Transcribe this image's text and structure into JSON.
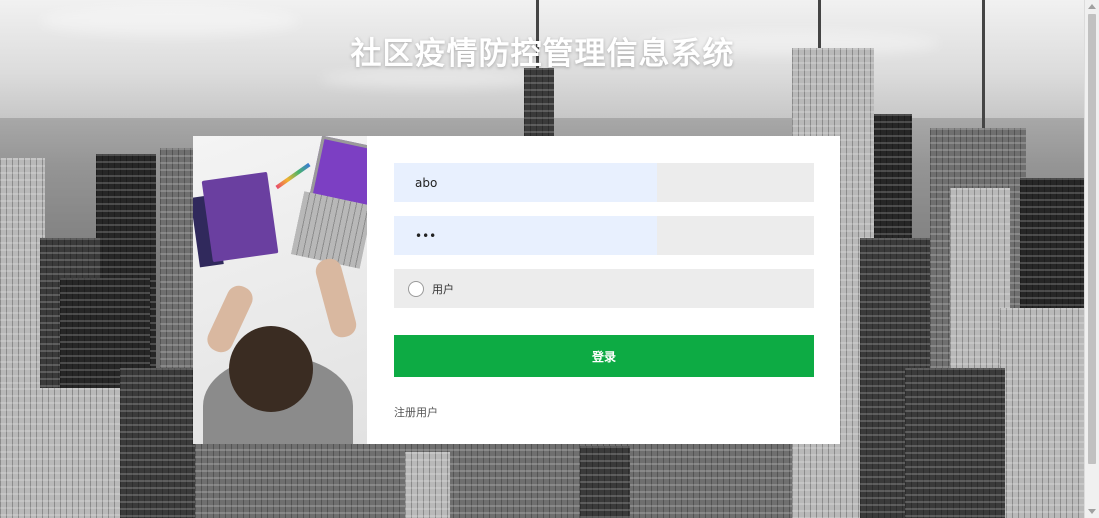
{
  "page": {
    "title": "社区疫情防控管理信息系统"
  },
  "login": {
    "username_value": "abo",
    "password_value": "•••",
    "role_option_label": "用户",
    "submit_label": "登录",
    "register_link": "注册用户"
  },
  "colors": {
    "button_green": "#0dab44",
    "autofill_blue": "#e8f0fe",
    "field_gray": "#ececec"
  }
}
